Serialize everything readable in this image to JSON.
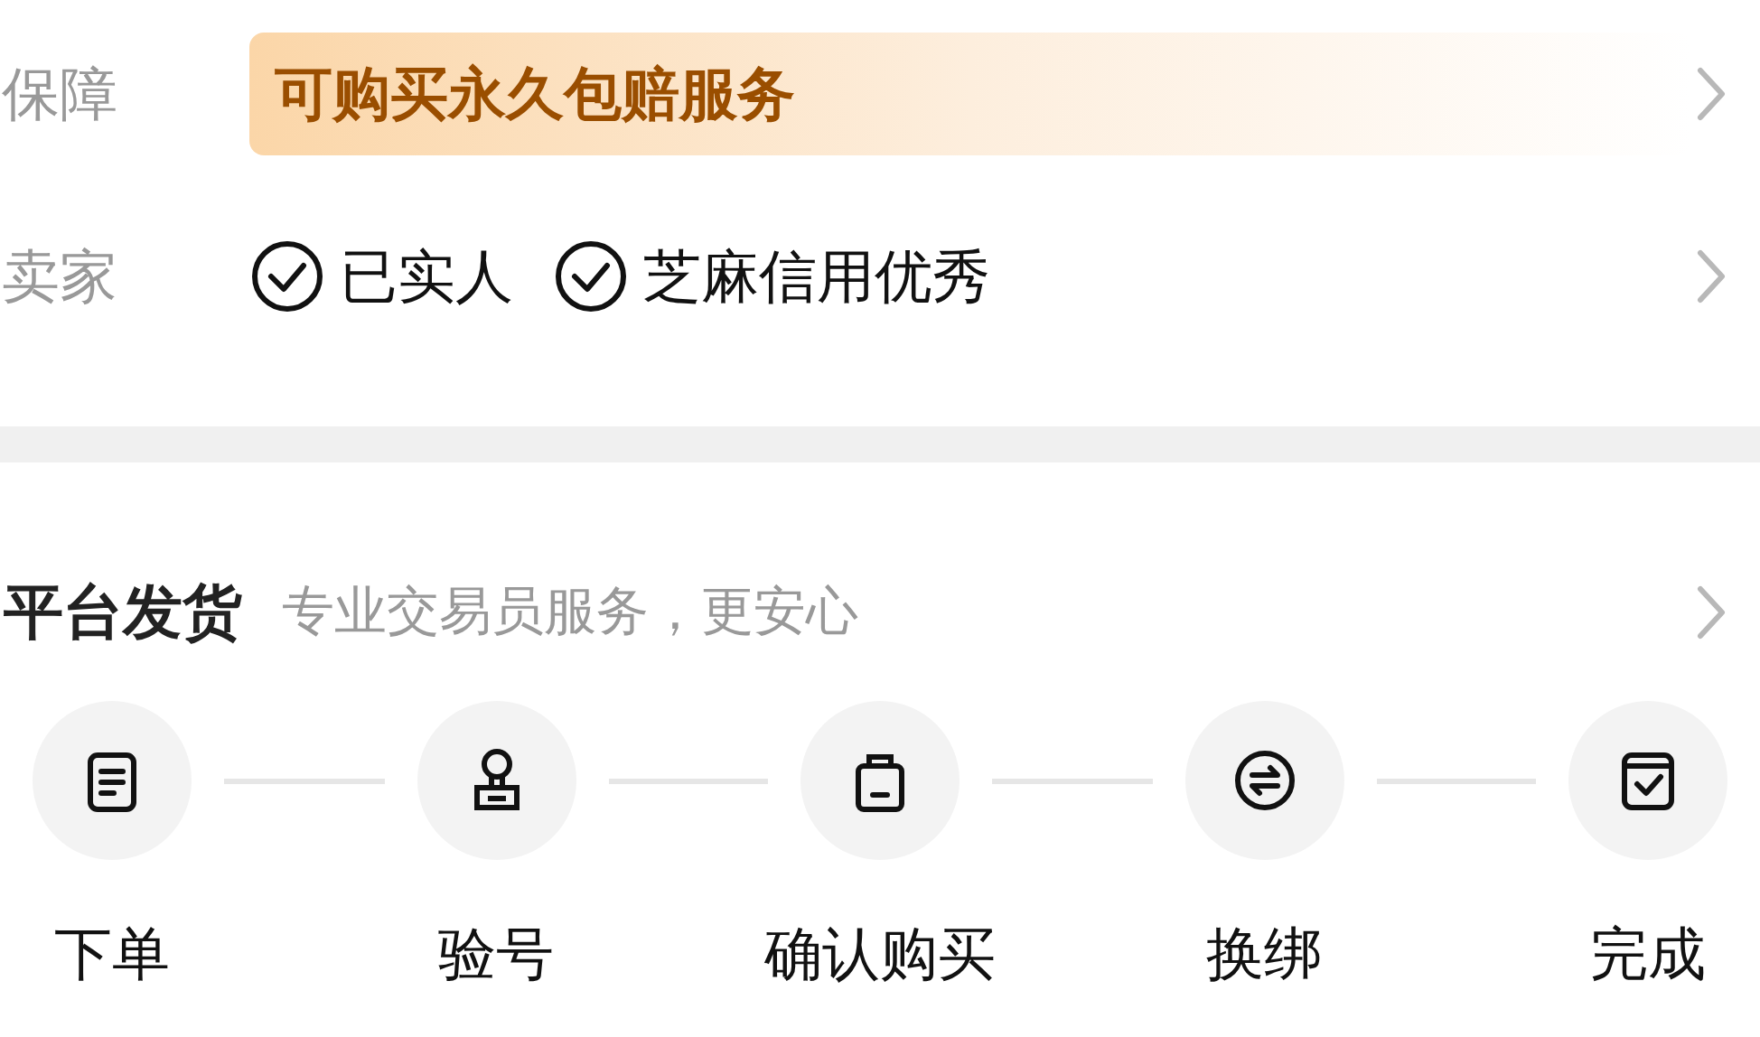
{
  "guarantee": {
    "label": "保障",
    "value": "可购买永久包赔服务"
  },
  "seller": {
    "label": "卖家",
    "badges": [
      "已实人",
      "芝麻信用优秀"
    ]
  },
  "delivery": {
    "title": "平台发货",
    "subtitle": "专业交易员服务，更安心",
    "steps": [
      {
        "kind": "order",
        "label": "下单"
      },
      {
        "kind": "stamp",
        "label": "验号"
      },
      {
        "kind": "bag",
        "label": "确认购买"
      },
      {
        "kind": "swap",
        "label": "换绑"
      },
      {
        "kind": "done",
        "label": "完成"
      }
    ]
  }
}
